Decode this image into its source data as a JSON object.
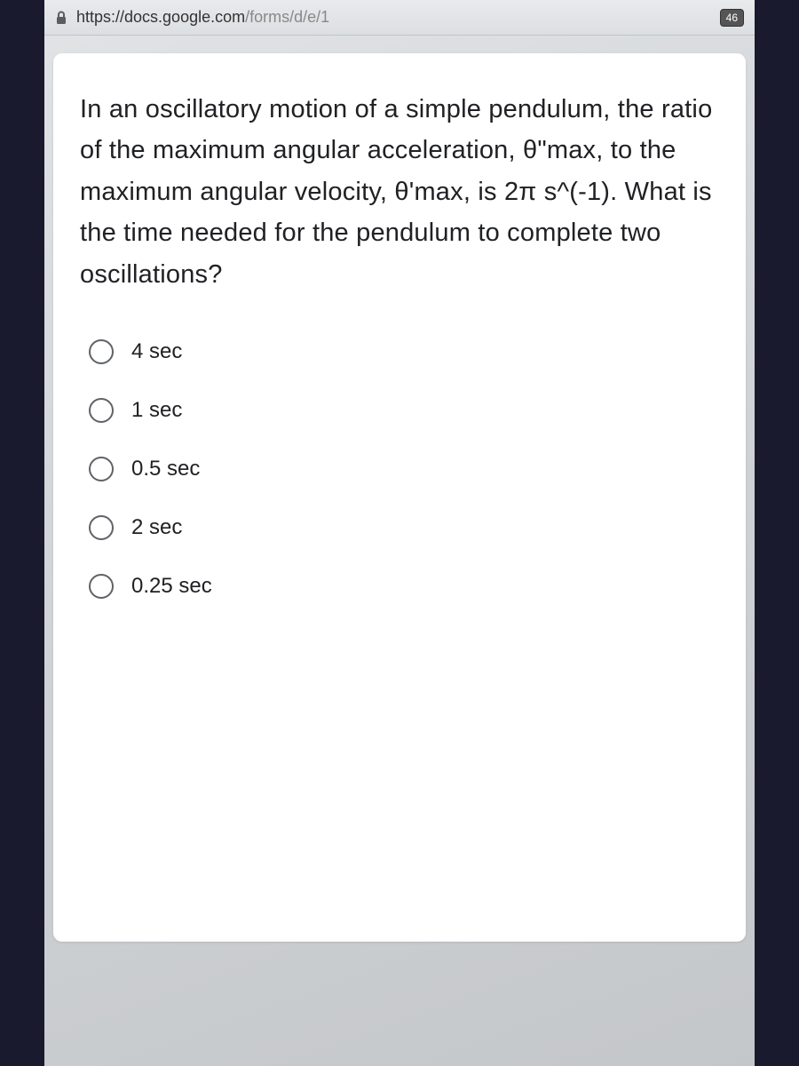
{
  "address_bar": {
    "url_protocol_domain": "https://docs.google.com",
    "url_path": "/forms/d/e/1",
    "tab_count": "46"
  },
  "form": {
    "question": "In an oscillatory motion of a simple pendulum, the ratio of the maximum angular acceleration, θ\"max, to the maximum angular velocity, θ'max, is 2π s^(-1). What is the time needed for the pendulum to complete two oscillations?",
    "options": [
      {
        "label": "4 sec"
      },
      {
        "label": "1 sec"
      },
      {
        "label": "0.5 sec"
      },
      {
        "label": "2 sec"
      },
      {
        "label": "0.25 sec"
      }
    ]
  }
}
